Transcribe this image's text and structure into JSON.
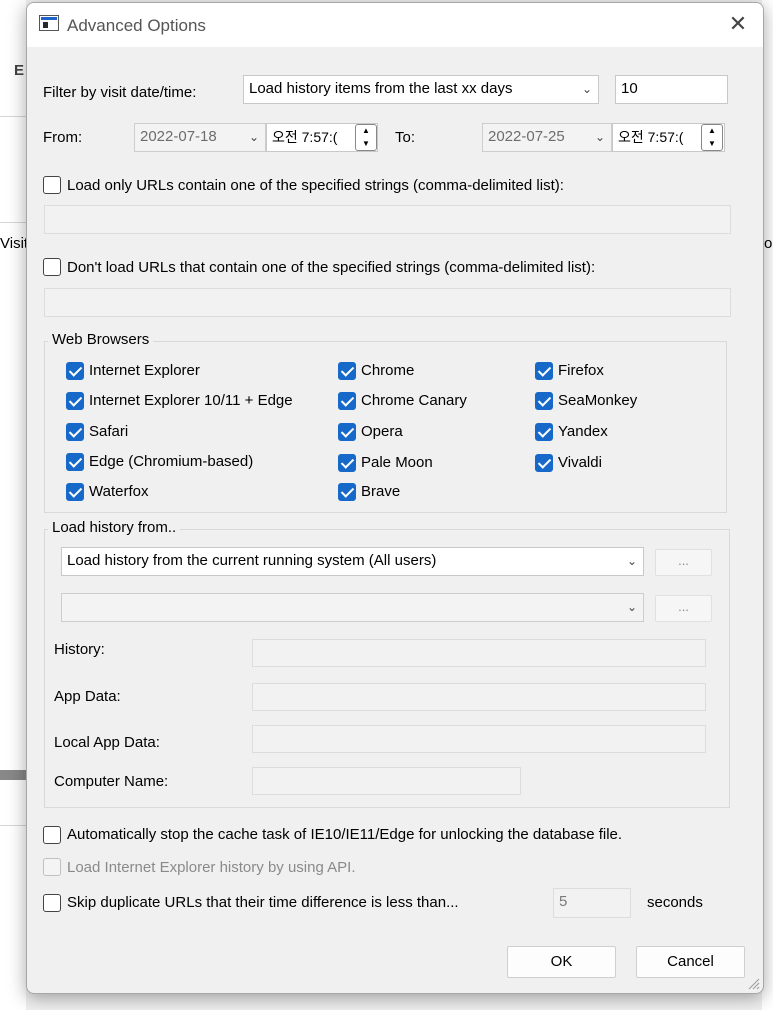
{
  "background": {
    "left_fragment_top": "E",
    "left_fragment_visit": "Visit",
    "right_fragment": "o"
  },
  "dialog": {
    "title": "Advanced Options",
    "close_glyph": "✕",
    "filter": {
      "label": "Filter by visit date/time:",
      "mode_value": "Load history items from the last xx days",
      "days_value": "10"
    },
    "from": {
      "label": "From:",
      "date": "2022-07-18",
      "time": "오전  7:57:("
    },
    "to": {
      "label": "To:",
      "date": "2022-07-25",
      "time": "오전  7:57:("
    },
    "load_only": {
      "label": "Load only URLs contain one of the specified strings (comma-delimited list):",
      "checked": false,
      "value": ""
    },
    "dont_load": {
      "label": "Don't load URLs that contain one of the specified strings (comma-delimited list):",
      "checked": false,
      "value": ""
    },
    "web_browsers": {
      "title": "Web Browsers",
      "items": [
        {
          "label": "Internet Explorer",
          "checked": true
        },
        {
          "label": "Internet Explorer 10/11 + Edge",
          "checked": true
        },
        {
          "label": "Safari",
          "checked": true
        },
        {
          "label": "Edge (Chromium-based)",
          "checked": true
        },
        {
          "label": "Waterfox",
          "checked": true
        },
        {
          "label": "Chrome",
          "checked": true
        },
        {
          "label": "Chrome Canary",
          "checked": true
        },
        {
          "label": "Opera",
          "checked": true
        },
        {
          "label": "Pale Moon",
          "checked": true
        },
        {
          "label": "Brave",
          "checked": true
        },
        {
          "label": "Firefox",
          "checked": true
        },
        {
          "label": "SeaMonkey",
          "checked": true
        },
        {
          "label": "Yandex",
          "checked": true
        },
        {
          "label": "Vivaldi",
          "checked": true
        }
      ]
    },
    "load_history": {
      "title": "Load history from..",
      "source_value": "Load history from the current running system (All users)",
      "browse_label": "...",
      "second_value": "",
      "second_browse_label": "...",
      "history_label": "History:",
      "history_value": "",
      "app_data_label": "App Data:",
      "app_data_value": "",
      "local_app_data_label": "Local App Data:",
      "local_app_data_value": "",
      "computer_name_label": "Computer Name:",
      "computer_name_value": ""
    },
    "auto_stop": {
      "label": "Automatically stop the cache task of IE10/IE11/Edge for unlocking the database file.",
      "checked": false
    },
    "ie_api": {
      "label": "Load Internet Explorer history by using API.",
      "checked": false
    },
    "skip_dup": {
      "label": "Skip duplicate URLs that their time difference is less than...",
      "checked": false,
      "seconds_value": "5",
      "seconds_label": "seconds"
    },
    "ok_label": "OK",
    "cancel_label": "Cancel"
  }
}
